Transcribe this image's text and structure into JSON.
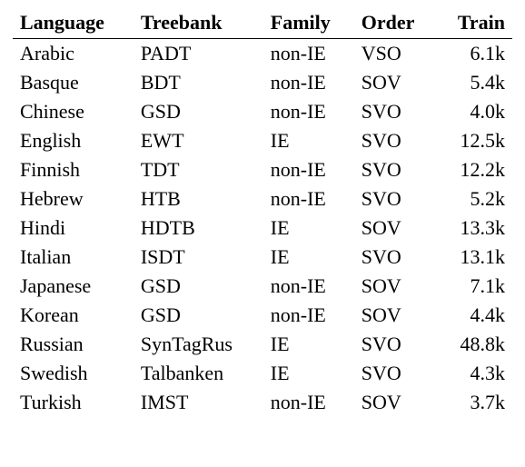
{
  "chart_data": {
    "type": "table",
    "columns": [
      "Language",
      "Treebank",
      "Family",
      "Order",
      "Train"
    ],
    "rows": [
      {
        "language": "Arabic",
        "treebank": "PADT",
        "family": "non-IE",
        "order": "VSO",
        "train": "6.1k"
      },
      {
        "language": "Basque",
        "treebank": "BDT",
        "family": "non-IE",
        "order": "SOV",
        "train": "5.4k"
      },
      {
        "language": "Chinese",
        "treebank": "GSD",
        "family": "non-IE",
        "order": "SVO",
        "train": "4.0k"
      },
      {
        "language": "English",
        "treebank": "EWT",
        "family": "IE",
        "order": "SVO",
        "train": "12.5k"
      },
      {
        "language": "Finnish",
        "treebank": "TDT",
        "family": "non-IE",
        "order": "SVO",
        "train": "12.2k"
      },
      {
        "language": "Hebrew",
        "treebank": "HTB",
        "family": "non-IE",
        "order": "SVO",
        "train": "5.2k"
      },
      {
        "language": "Hindi",
        "treebank": "HDTB",
        "family": "IE",
        "order": "SOV",
        "train": "13.3k"
      },
      {
        "language": "Italian",
        "treebank": "ISDT",
        "family": "IE",
        "order": "SVO",
        "train": "13.1k"
      },
      {
        "language": "Japanese",
        "treebank": "GSD",
        "family": "non-IE",
        "order": "SOV",
        "train": "7.1k"
      },
      {
        "language": "Korean",
        "treebank": "GSD",
        "family": "non-IE",
        "order": "SOV",
        "train": "4.4k"
      },
      {
        "language": "Russian",
        "treebank": "SynTagRus",
        "family": "IE",
        "order": "SVO",
        "train": "48.8k"
      },
      {
        "language": "Swedish",
        "treebank": "Talbanken",
        "family": "IE",
        "order": "SVO",
        "train": "4.3k"
      },
      {
        "language": "Turkish",
        "treebank": "IMST",
        "family": "non-IE",
        "order": "SOV",
        "train": "3.7k"
      }
    ]
  }
}
